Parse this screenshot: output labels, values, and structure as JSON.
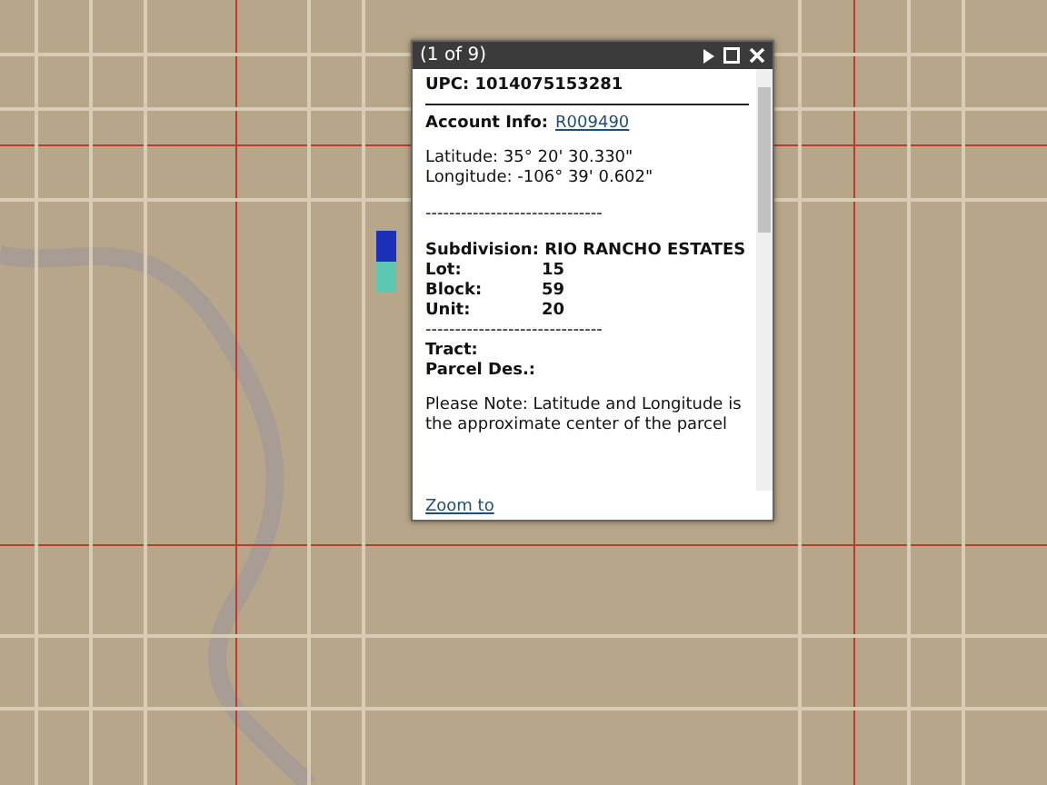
{
  "popup": {
    "title": "(1 of 9)",
    "upc": "UPC: 1014075153281",
    "account": {
      "label": "Account Info:",
      "link": "R009490"
    },
    "coordinates": [
      "Latitude: 35° 20' 30.330\"",
      "Longitude: -106° 39' 0.602\""
    ],
    "separator": "------------------------------",
    "subdivision": "Subdivision: RIO RANCHO ESTATES",
    "fields": [
      {
        "label": "Lot:",
        "value": "15"
      },
      {
        "label": "Block:",
        "value": "59"
      },
      {
        "label": "Unit:",
        "value": "20"
      }
    ],
    "separator_2": "------------------------------",
    "empty_fields": [
      "Tract:",
      "Parcel Des.:"
    ],
    "note": "Please Note: Latitude and Longitude is the approximate center of the parcel",
    "zoom_link": "Zoom to"
  }
}
